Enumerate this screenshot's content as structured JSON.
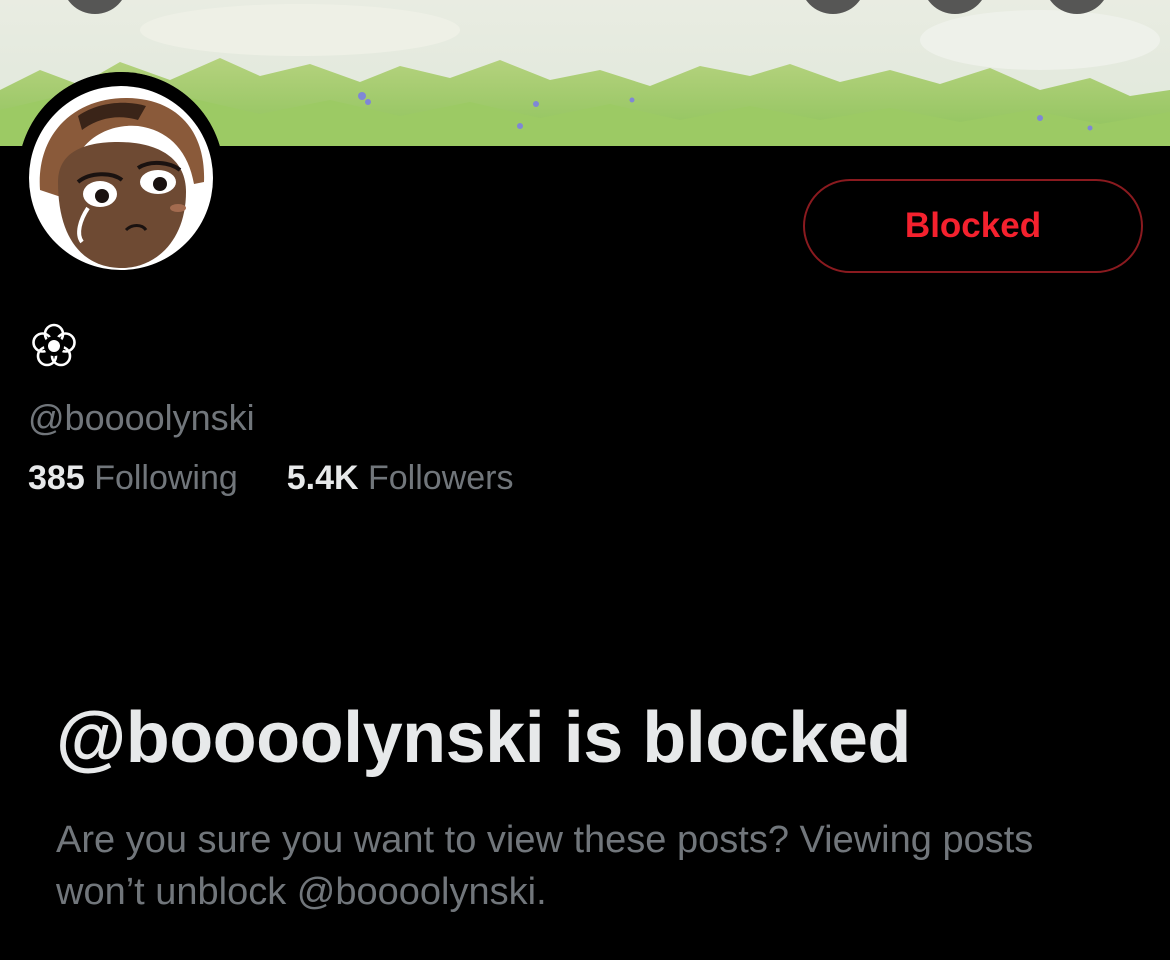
{
  "profile": {
    "display_name_emoji": "❀",
    "handle": "@boooolynski",
    "following_count": "385",
    "following_label": "Following",
    "followers_count": "5.4K",
    "followers_label": "Followers"
  },
  "actions": {
    "blocked_button_label": "Blocked"
  },
  "blocked_notice": {
    "title": "@boooolynski is blocked",
    "description": "Are you sure you want to view these posts? Viewing posts won’t unblock @boooolynski."
  },
  "colors": {
    "background": "#000000",
    "blocked_red": "#f4212e",
    "secondary_text": "#71767b",
    "primary_text": "#e7e9ea"
  },
  "icons": {
    "header_buttons": [
      "back-icon",
      "search-icon",
      "share-icon",
      "more-icon"
    ]
  }
}
